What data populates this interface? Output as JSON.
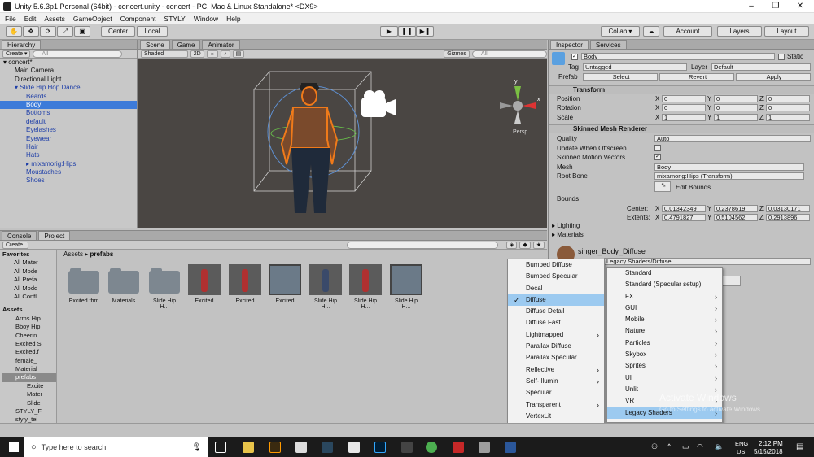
{
  "window": {
    "title": "Unity 5.6.3p1 Personal (64bit) - concert.unity - concert - PC, Mac & Linux Standalone* <DX9>",
    "minimize": "–",
    "maximize": "❐",
    "close": "✕"
  },
  "menubar": [
    "File",
    "Edit",
    "Assets",
    "GameObject",
    "Component",
    "STYLY",
    "Window",
    "Help"
  ],
  "toolbar": {
    "center": "Center",
    "local": "Local",
    "collab": "Collab ▾",
    "account": "Account",
    "layers": "Layers",
    "layout": "Layout"
  },
  "hierarchy": {
    "tab": "Hierarchy",
    "create": "Create ▾",
    "search": "All",
    "items": [
      {
        "label": "concert*",
        "indent": 0,
        "cls": ""
      },
      {
        "label": "Main Camera",
        "indent": 1,
        "cls": ""
      },
      {
        "label": "Directional Light",
        "indent": 1,
        "cls": ""
      },
      {
        "label": "Slide Hip Hop Dance",
        "indent": 1,
        "cls": "blue"
      },
      {
        "label": "Beards",
        "indent": 2,
        "cls": "blue"
      },
      {
        "label": "Body",
        "indent": 2,
        "cls": "sel"
      },
      {
        "label": "Bottoms",
        "indent": 2,
        "cls": "blue"
      },
      {
        "label": "default",
        "indent": 2,
        "cls": "blue"
      },
      {
        "label": "Eyelashes",
        "indent": 2,
        "cls": "blue"
      },
      {
        "label": "Eyewear",
        "indent": 2,
        "cls": "blue"
      },
      {
        "label": "Hair",
        "indent": 2,
        "cls": "blue"
      },
      {
        "label": "Hats",
        "indent": 2,
        "cls": "blue"
      },
      {
        "label": "mixamorig:Hips",
        "indent": 2,
        "cls": "blue"
      },
      {
        "label": "Moustaches",
        "indent": 2,
        "cls": "blue"
      },
      {
        "label": "Shoes",
        "indent": 2,
        "cls": "blue"
      }
    ]
  },
  "scene": {
    "tabs": [
      "Scene",
      "Game",
      "Animator"
    ],
    "shaded": "Shaded",
    "mode2d": "2D",
    "gizmos": "Gizmos ▾",
    "search": "All",
    "persp": "Persp",
    "axis_y": "y",
    "axis_x": "x"
  },
  "inspector": {
    "tabs": [
      "Inspector",
      "Services"
    ],
    "name": "Body",
    "static": "Static",
    "tag_label": "Tag",
    "tag": "Untagged",
    "layer_label": "Layer",
    "layer": "Default",
    "prefab_label": "Prefab",
    "select": "Select",
    "revert": "Revert",
    "apply": "Apply",
    "transform": {
      "title": "Transform",
      "position": "Position",
      "rotation": "Rotation",
      "scale": "Scale",
      "pos": [
        "0",
        "0",
        "0"
      ],
      "rot": [
        "0",
        "0",
        "0"
      ],
      "scl": [
        "1",
        "1",
        "1"
      ]
    },
    "smr": {
      "title": "Skinned Mesh Renderer",
      "quality_label": "Quality",
      "quality": "Auto",
      "update_label": "Update When Offscreen",
      "motion_label": "Skinned Motion Vectors",
      "mesh_label": "Mesh",
      "mesh": "Body",
      "rootbone_label": "Root Bone",
      "rootbone": "mixamorig:Hips (Transform)",
      "editbounds": "Edit Bounds",
      "bounds_label": "Bounds",
      "center_label": "Center:",
      "extents_label": "Extents:",
      "center": [
        "0.01342349",
        "0.2378619",
        "0.03130171"
      ],
      "extents": [
        "0.4791827",
        "0.5104562",
        "0.2913896"
      ]
    },
    "lighting": "Lighting",
    "materials": "Materials",
    "material_name": "singer_Body_Diffuse",
    "shader": "Legacy Shaders/Diffuse"
  },
  "project": {
    "tabs": [
      "Console",
      "Project"
    ],
    "create": "Create ▾",
    "breadcrumb": [
      "Assets",
      "prefabs"
    ],
    "favorites_label": "Favorites",
    "favorites": [
      "All Mater",
      "All Mode",
      "All Prefa",
      "All Modd",
      "All Confl"
    ],
    "assets_label": "Assets",
    "assets_tree": [
      "Arms Hip",
      "Bboy Hip",
      "Cheerin",
      "Excited S",
      "Excited.f",
      "female_",
      "Material",
      "prefabs",
      "Excite",
      "Mater",
      "Slide",
      "STYLY_F",
      "styly_tei"
    ],
    "grid": [
      {
        "label": "Excited.fbm",
        "kind": "folder"
      },
      {
        "label": "Materials",
        "kind": "folder"
      },
      {
        "label": "Slide Hip H...",
        "kind": "folder"
      },
      {
        "label": "Excited",
        "kind": "model"
      },
      {
        "label": "Excited",
        "kind": "model"
      },
      {
        "label": "Excited",
        "kind": "anim"
      },
      {
        "label": "Slide Hip H...",
        "kind": "model2"
      },
      {
        "label": "Slide Hip H...",
        "kind": "model"
      },
      {
        "label": "Slide Hip H...",
        "kind": "anim"
      }
    ]
  },
  "shader_menu_left": [
    {
      "label": "Bumped Diffuse"
    },
    {
      "label": "Bumped Specular"
    },
    {
      "label": "Decal"
    },
    {
      "label": "Diffuse",
      "checked": true,
      "hl": true
    },
    {
      "label": "Diffuse Detail"
    },
    {
      "label": "Diffuse Fast"
    },
    {
      "label": "Lightmapped",
      "sub": true
    },
    {
      "label": "Parallax Diffuse"
    },
    {
      "label": "Parallax Specular"
    },
    {
      "label": "Reflective",
      "sub": true
    },
    {
      "label": "Self-Illumin",
      "sub": true
    },
    {
      "label": "Specular"
    },
    {
      "label": "Transparent",
      "sub": true
    },
    {
      "label": "VertexLit"
    }
  ],
  "shader_menu_right": [
    {
      "label": "Standard"
    },
    {
      "label": "Standard (Specular setup)"
    },
    {
      "label": "FX",
      "sub": true
    },
    {
      "label": "GUI",
      "sub": true
    },
    {
      "label": "Mobile",
      "sub": true
    },
    {
      "label": "Nature",
      "sub": true
    },
    {
      "label": "Particles",
      "sub": true
    },
    {
      "label": "Skybox",
      "sub": true
    },
    {
      "label": "Sprites",
      "sub": true
    },
    {
      "label": "UI",
      "sub": true
    },
    {
      "label": "Unlit",
      "sub": true
    },
    {
      "label": "VR",
      "sub": true
    },
    {
      "label": "Legacy Shaders",
      "sub": true,
      "hl": true
    }
  ],
  "watermark": {
    "title": "Activate Windows",
    "sub": "Go to Settings to activate Windows."
  },
  "taskbar": {
    "search": "Type here to search",
    "lang": "ENG",
    "region": "US",
    "time": "2:12 PM",
    "date": "5/15/2018"
  },
  "colors": {
    "accent": "#3d7bd9",
    "highlight": "#9ccaf0",
    "orange": "#f07a1a"
  }
}
